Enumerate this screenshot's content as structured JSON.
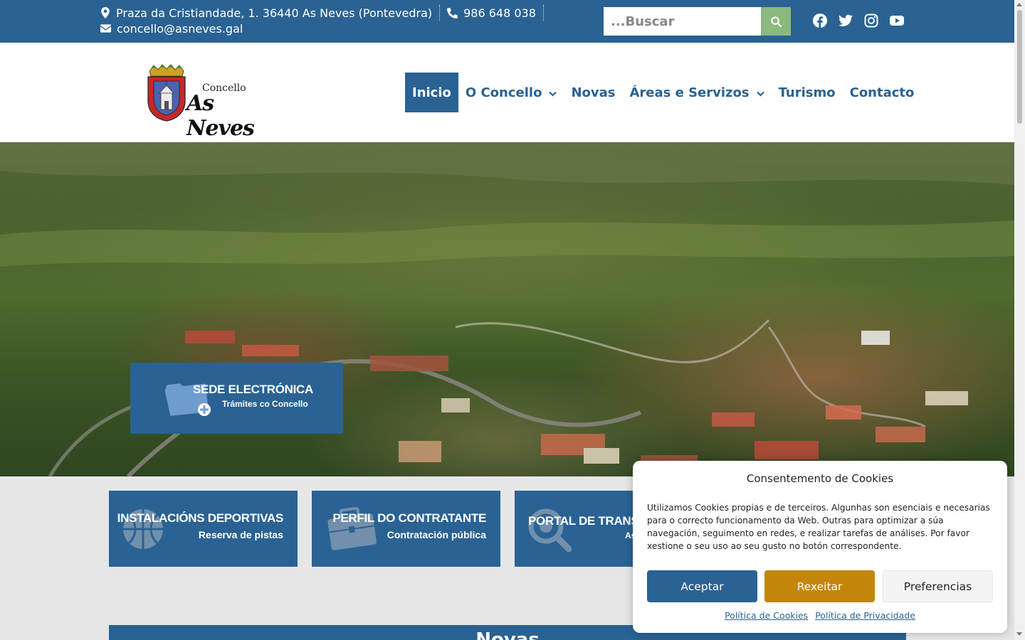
{
  "topbar": {
    "address": "Praza da Cristiandade, 1. 36440 As Neves (Pontevedra)",
    "phone": "986 648 038",
    "email": "concello@asneves.gal",
    "search_placeholder": "...Buscar",
    "socials": [
      "facebook-icon",
      "twitter-icon",
      "instagram-icon",
      "youtube-icon"
    ]
  },
  "logo": {
    "small_text": "Concello",
    "big_text": "As Neves"
  },
  "nav": {
    "items": [
      {
        "label": "Inicio",
        "active": true,
        "dropdown": false
      },
      {
        "label": "O Concello",
        "active": false,
        "dropdown": true
      },
      {
        "label": "Novas",
        "active": false,
        "dropdown": false
      },
      {
        "label": "Áreas e Servizos",
        "active": false,
        "dropdown": true
      },
      {
        "label": "Turismo",
        "active": false,
        "dropdown": false
      },
      {
        "label": "Contacto",
        "active": false,
        "dropdown": false
      }
    ]
  },
  "hero": {
    "sede_title": "SEDE ELECTRÓNICA",
    "sede_subtitle": "Trámites co Concello"
  },
  "cards": [
    {
      "title": "INSTALACIÓNS DEPORTIVAS",
      "subtitle": "Reserva de pistas",
      "icon": "basketball-icon"
    },
    {
      "title": "PERFIL DO CONTRATANTE",
      "subtitle": "Contratación pública",
      "icon": "briefcase-icon"
    },
    {
      "title": "PORTAL DE TRANS",
      "subtitle": "As",
      "icon": "magnifier-icon"
    }
  ],
  "news": {
    "title": "Novas"
  },
  "cookie": {
    "title": "Consentemento de Cookies",
    "text": "Utilizamos Cookies propias e de terceiros. Algunhas son esenciais e necesarias para o correcto funcionamento da Web. Outras para optimizar a súa navegación, seguimento en redes, e realizar tarefas de análises. Por favor xestione o seu uso ao seu gusto no botón correspondente.",
    "accept": "Aceptar",
    "reject": "Rexeitar",
    "preferences": "Preferencias",
    "link_cookies": "Política de Cookies",
    "link_privacy": "Política de Privacidade"
  },
  "colors": {
    "primary": "#2a6293",
    "search_button": "#8aba7e",
    "reject_button": "#c4860a"
  }
}
